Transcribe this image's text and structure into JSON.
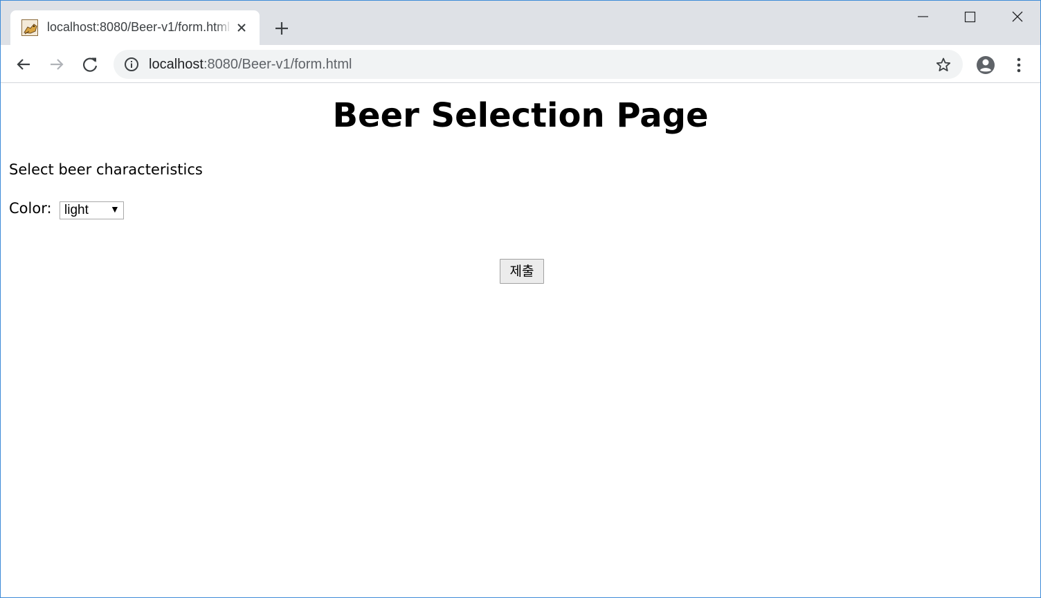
{
  "browser": {
    "tab": {
      "title": "localhost:8080/Beer-v1/form.html",
      "favicon": "tomcat-icon"
    },
    "address": {
      "host": "localhost",
      "rest": ":8080/Beer-v1/form.html"
    },
    "icons": {
      "back": "arrow-left-icon",
      "forward": "arrow-right-icon",
      "reload": "reload-icon",
      "info": "info-icon",
      "bookmark": "star-icon",
      "profile": "account-icon",
      "menu": "kebab-menu-icon",
      "new_tab": "plus-icon",
      "close_tab": "close-icon"
    },
    "colors": {
      "tabstrip": "#dee1e6",
      "omnibox": "#f1f3f4",
      "window_border": "#3c8ad8"
    }
  },
  "page": {
    "title": "Beer Selection Page",
    "subtitle": "Select beer characteristics",
    "color_field": {
      "label": "Color:",
      "selected": "light"
    },
    "submit_label": "제출"
  }
}
